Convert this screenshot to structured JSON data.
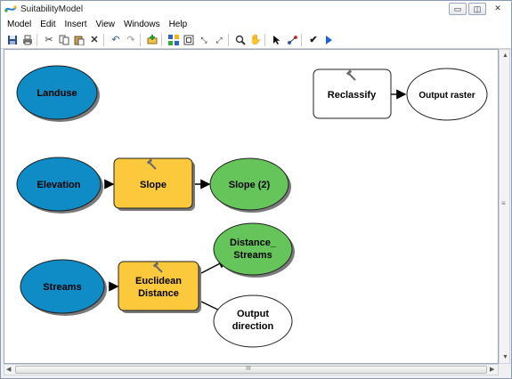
{
  "window": {
    "title": "SuitabilityModel"
  },
  "menubar": {
    "items": [
      "Model",
      "Edit",
      "Insert",
      "View",
      "Windows",
      "Help"
    ]
  },
  "toolbar": {
    "icons": [
      "save-icon",
      "print-icon",
      "cut-icon",
      "copy-icon",
      "paste-icon",
      "delete-icon",
      "undo-icon",
      "redo-icon",
      "add-data-icon",
      "auto-layout-icon",
      "full-extent-icon",
      "zoom-in-fixed-icon",
      "zoom-out-fixed-icon",
      "zoom-icon",
      "pan-icon",
      "select-icon",
      "connect-icon",
      "validate-icon",
      "run-icon"
    ]
  },
  "model": {
    "nodes": {
      "landuse": "Landuse",
      "elevation": "Elevation",
      "slope_tool": "Slope",
      "slope_out": "Slope (2)",
      "streams": "Streams",
      "euclid_tool_line1": "Euclidean",
      "euclid_tool_line2": "Distance",
      "dist_out_line1": "Distance_",
      "dist_out_line2": "Streams",
      "out_dir_line1": "Output",
      "out_dir_line2": "direction",
      "reclassify": "Reclassify",
      "output_raster": "Output raster"
    }
  },
  "colors": {
    "input_data": "#0f8bc6",
    "tool": "#fdc93c",
    "derived_data": "#66c55a",
    "empty_fill": "#ffffff",
    "outline": "#1f1f1f"
  },
  "scrollbars": {
    "vertical_grip": "≡",
    "horizontal_grip": "III"
  }
}
